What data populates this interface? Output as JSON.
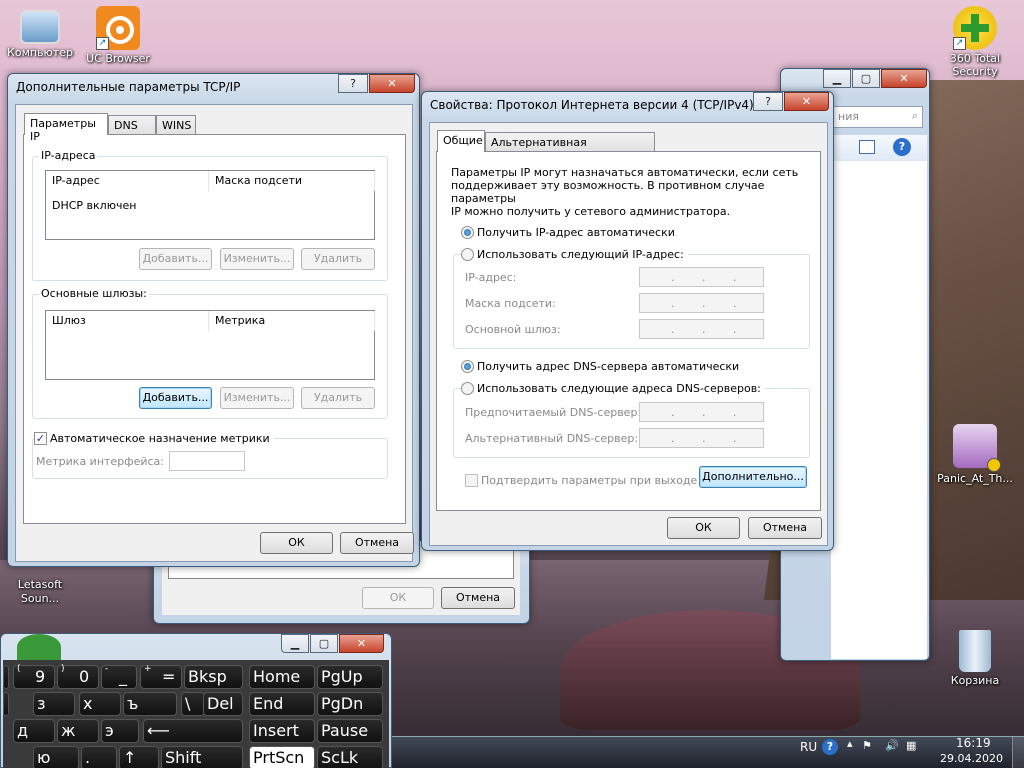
{
  "desktop": {
    "icons": [
      {
        "label": "Компьютер",
        "icon": "computer-icon"
      },
      {
        "label": "UC Browser",
        "icon": "uc-browser-icon"
      },
      {
        "label": "360 Total Security",
        "icon": "360-security-icon"
      },
      {
        "label": "Panic_At_Th...",
        "icon": "music-file-icon"
      },
      {
        "label": "Letasoft Soun...",
        "icon": "letasoft-icon"
      },
      {
        "label": "Корзина",
        "icon": "recycle-bin-icon"
      }
    ]
  },
  "back_window": {
    "search_placeholder": "ния",
    "ok": "ОК",
    "cancel": "Отмена"
  },
  "advanced_dialog": {
    "title": "Дополнительные параметры TCP/IP",
    "help": "?",
    "close": "✕",
    "tabs": [
      "Параметры IP",
      "DNS",
      "WINS"
    ],
    "ip_group": "IP-адреса",
    "ip_headers": [
      "IP-адрес",
      "Маска подсети"
    ],
    "ip_row": "DHCP включен",
    "ip_buttons": [
      "Добавить...",
      "Изменить...",
      "Удалить"
    ],
    "gw_group": "Основные шлюзы:",
    "gw_headers": [
      "Шлюз",
      "Метрика"
    ],
    "gw_buttons": [
      "Добавить...",
      "Изменить...",
      "Удалить"
    ],
    "auto_metric": "Автоматическое назначение метрики",
    "auto_metric_checked": true,
    "iface_metric_label": "Метрика интерфейса:",
    "ok": "ОК",
    "cancel": "Отмена"
  },
  "ipv4_dialog": {
    "title": "Свойства: Протокол Интернета версии 4 (TCP/IPv4)",
    "help": "?",
    "close": "✕",
    "tabs": [
      "Общие",
      "Альтернативная конфигурация"
    ],
    "description": [
      "Параметры IP могут назначаться автоматически, если сеть",
      "поддерживает эту возможность. В противном случае параметры",
      "IP можно получить у сетевого администратора."
    ],
    "auto_ip": "Получить IP-адрес автоматически",
    "manual_ip": "Использовать следующий IP-адрес:",
    "ip_label": "IP-адрес:",
    "mask_label": "Маска подсети:",
    "gw_label": "Основной шлюз:",
    "auto_dns": "Получить адрес DNS-сервера автоматически",
    "manual_dns": "Использовать следующие адреса DNS-серверов:",
    "pref_dns": "Предпочитаемый DNS-сервер:",
    "alt_dns": "Альтернативный DNS-сервер:",
    "confirm": "Подтвердить параметры при выходе",
    "advanced": "Дополнительно...",
    "ok": "ОК",
    "cancel": "Отмена",
    "dot": "."
  },
  "keyboard": {
    "keys": [
      "(",
      "9",
      ")",
      "0",
      "-",
      "_",
      "+",
      "=",
      "Bksp",
      "Home",
      "PgUp",
      "х",
      "з",
      "х",
      "ъ",
      "\\",
      "Del",
      "End",
      "PgDn",
      "д",
      "ж",
      "э",
      "⟵",
      "Insert",
      "Pause",
      "ю",
      ".",
      "↑",
      "Shift",
      "PrtScn",
      "ScLk"
    ]
  },
  "taskbar": {
    "lang": "RU",
    "time": "16:19",
    "date": "29.04.2020"
  }
}
